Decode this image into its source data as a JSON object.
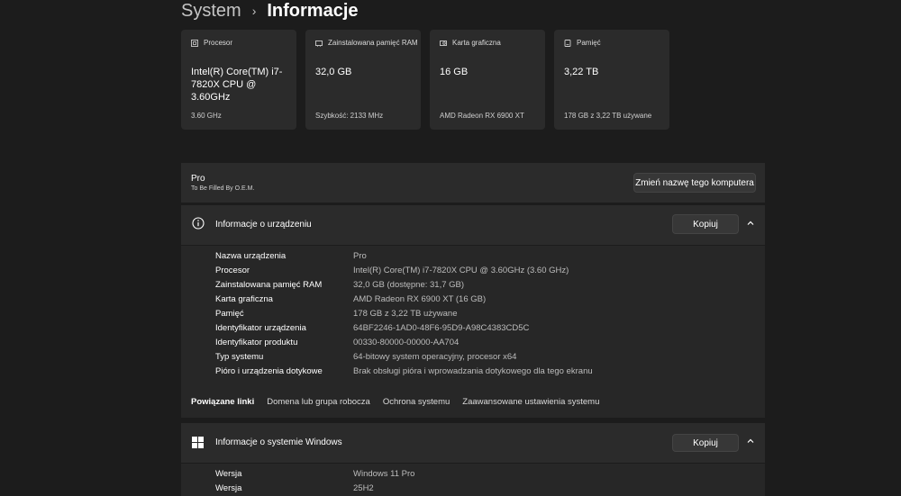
{
  "breadcrumb": {
    "root": "System",
    "separator": "›",
    "current": "Informacje"
  },
  "cards": [
    {
      "icon": "processor-icon",
      "label": "Procesor",
      "value": "Intel(R) Core(TM) i7-7820X CPU @ 3.60GHz",
      "sub": "3.60 GHz"
    },
    {
      "icon": "ram-icon",
      "label": "Zainstalowana pamięć RAM",
      "value": "32,0 GB",
      "sub": "Szybkość: 2133 MHz"
    },
    {
      "icon": "gpu-icon",
      "label": "Karta graficzna",
      "value": "16 GB",
      "sub": "AMD Radeon RX 6900 XT"
    },
    {
      "icon": "storage-icon",
      "label": "Pamięć",
      "value": "3,22 TB",
      "sub": "178 GB z 3,22 TB używane"
    }
  ],
  "pc": {
    "name": "Pro",
    "manufacturer": "To Be Filled By O.E.M.",
    "rename_label": "Zmień nazwę tego komputera"
  },
  "device_info": {
    "title": "Informacje o urządzeniu",
    "copy_label": "Kopiuj",
    "rows": [
      {
        "label": "Nazwa urządzenia",
        "value": "Pro"
      },
      {
        "label": "Procesor",
        "value": "Intel(R) Core(TM) i7-7820X CPU @ 3.60GHz (3.60 GHz)"
      },
      {
        "label": "Zainstalowana pamięć RAM",
        "value": "32,0 GB (dostępne: 31,7 GB)"
      },
      {
        "label": "Karta graficzna",
        "value": "AMD Radeon RX 6900 XT (16 GB)"
      },
      {
        "label": "Pamięć",
        "value": "178 GB z 3,22 TB używane"
      },
      {
        "label": "Identyfikator urządzenia",
        "value": "64BF2246-1AD0-48F6-95D9-A98C4383CD5C"
      },
      {
        "label": "Identyfikator produktu",
        "value": "00330-80000-00000-AA704"
      },
      {
        "label": "Typ systemu",
        "value": "64-bitowy system operacyjny, procesor x64"
      },
      {
        "label": "Pióro i urządzenia dotykowe",
        "value": "Brak obsługi pióra i wprowadzania dotykowego dla tego ekranu"
      }
    ]
  },
  "related": {
    "label": "Powiązane linki",
    "links": [
      "Domena lub grupa robocza",
      "Ochrona systemu",
      "Zaawansowane ustawienia systemu"
    ]
  },
  "windows_info": {
    "title": "Informacje o systemie Windows",
    "copy_label": "Kopiuj",
    "rows": [
      {
        "label": "Wersja",
        "value": "Windows 11 Pro"
      },
      {
        "label": "Wersja",
        "value": "25H2"
      }
    ]
  }
}
